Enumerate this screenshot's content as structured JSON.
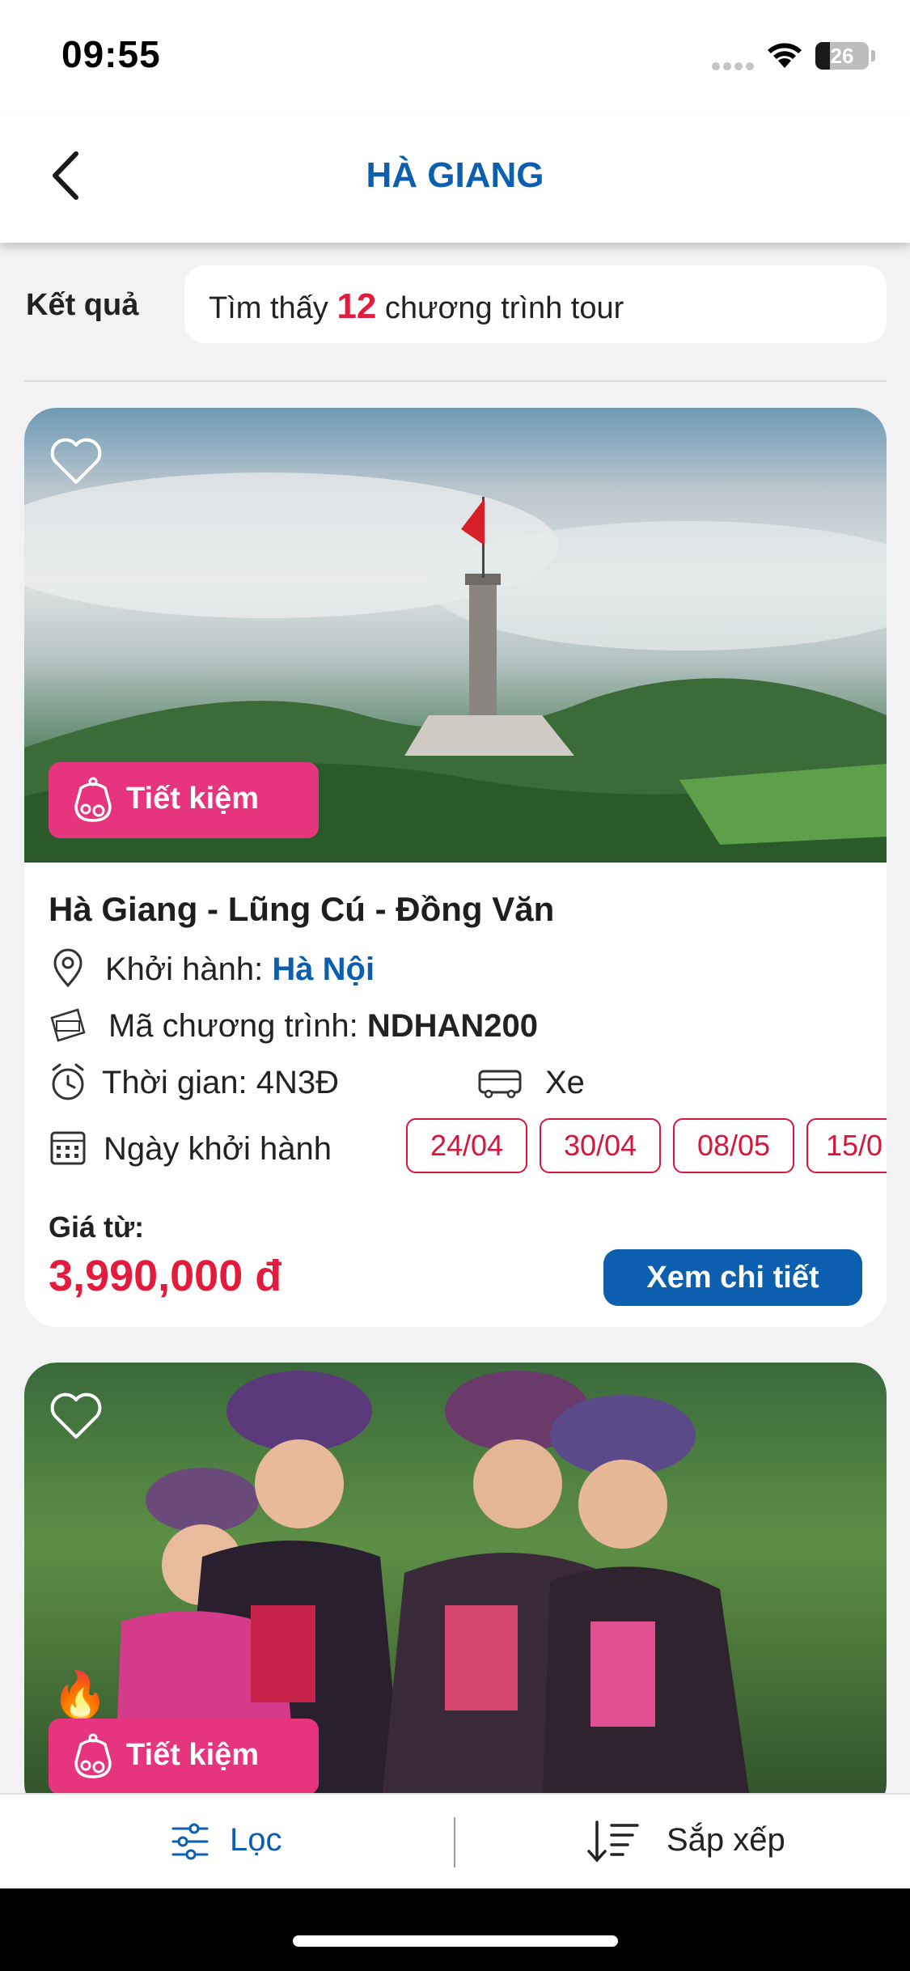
{
  "status_bar": {
    "time": "09:55",
    "battery": "26"
  },
  "header": {
    "title": "HÀ GIANG"
  },
  "results": {
    "label": "Kết quả",
    "prefix": "Tìm thấy",
    "count": "12",
    "suffix": "chương trình tour"
  },
  "tours": [
    {
      "badge": "Tiết kiệm",
      "title": "Hà Giang - Lũng Cú - Đồng Văn",
      "departure_label": "Khởi hành:",
      "departure_value": "Hà Nội",
      "code_label": "Mã chương trình:",
      "code_value": "NDHAN200",
      "duration": "Thời gian: 4N3Đ",
      "transport": "Xe",
      "dates_label": "Ngày khởi hành",
      "dates": [
        "24/04",
        "30/04",
        "08/05",
        "15/0"
      ],
      "price_label": "Giá từ:",
      "price": "3,990,000 đ",
      "detail_button": "Xem chi tiết"
    },
    {
      "badge": "Tiết kiệm",
      "fire": "🔥"
    }
  ],
  "bottom_bar": {
    "filter": "Lọc",
    "sort": "Sắp xếp"
  },
  "colors": {
    "brand_blue": "#0b5fae",
    "price_red": "#e31b3c",
    "badge_pink": "#e6357e"
  },
  "icons": [
    "back-icon",
    "heart-icon",
    "piggy-bank-icon",
    "location-icon",
    "ticket-icon",
    "clock-icon",
    "bus-icon",
    "calendar-icon",
    "filter-icon",
    "sort-icon",
    "fire-icon"
  ]
}
